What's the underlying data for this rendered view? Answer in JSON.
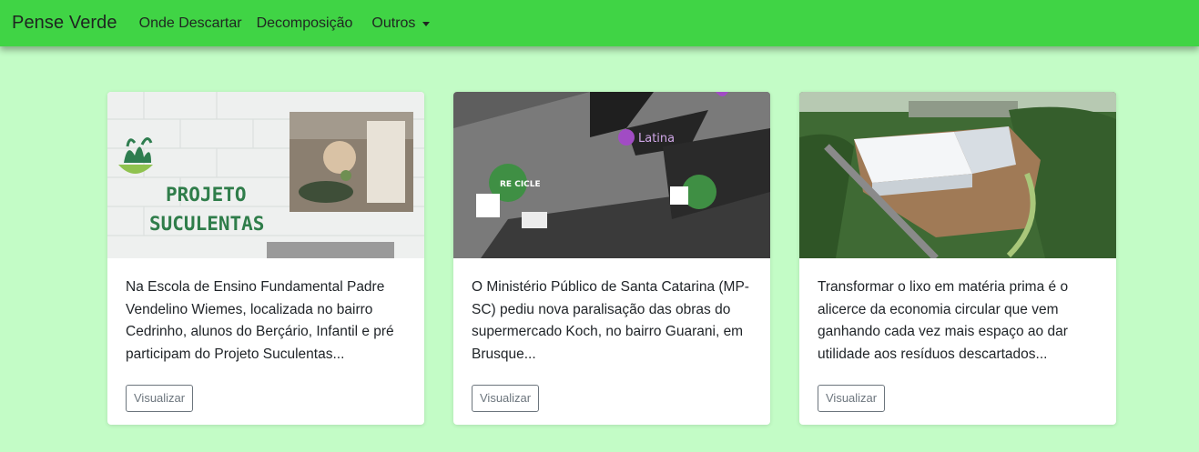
{
  "navbar": {
    "brand": "Pense Verde",
    "links": [
      "Onde Descartar",
      "Decomposição"
    ],
    "dropdown_label": "Outros",
    "background_color": "#40d445"
  },
  "page": {
    "background_color": "#c3fcc6"
  },
  "cards": [
    {
      "text": "Na Escola de Ensino Fundamental Padre Vendelino Wiemes, localizada no bairro Cedrinho, alunos do Berçário, Infantil e pré participam do Projeto Suculentas...",
      "button_label": "Visualizar",
      "image": {
        "title_line1": "PROJETO",
        "title_line2": "SUCULENTAS"
      }
    },
    {
      "text": "O Ministério Público de Santa Catarina (MP-SC) pediu nova paralisação das obras do supermercado Koch, no bairro Guarani, em Brusque...",
      "button_label": "Visualizar",
      "image": {
        "brand": "Latina",
        "tag": "RE CICLE"
      }
    },
    {
      "text": "Transformar o lixo em matéria prima é o alicerce da economia circular que vem ganhando cada vez mais espaço ao dar utilidade aos resíduos descartados...",
      "button_label": "Visualizar",
      "image": {}
    }
  ]
}
